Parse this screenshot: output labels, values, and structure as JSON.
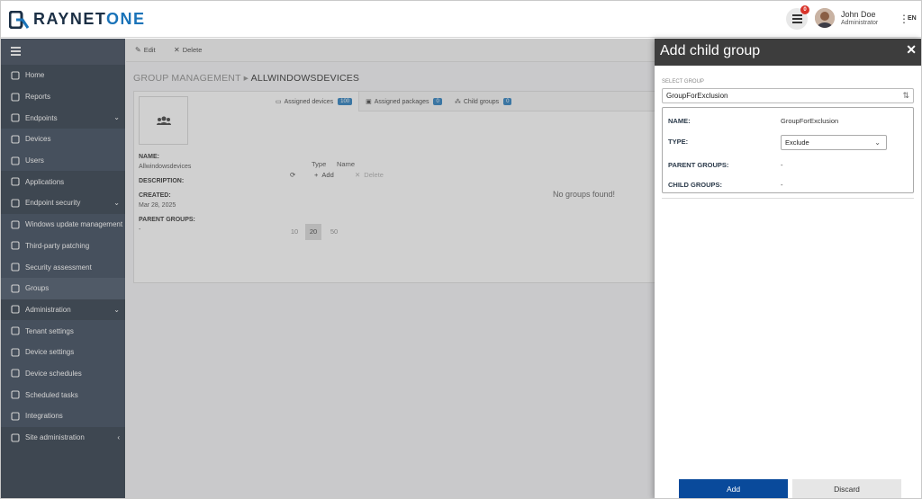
{
  "header": {
    "brand_part1": "RAYNET",
    "brand_part2": "ONE",
    "notification_count": "0",
    "user_name": "John Doe",
    "user_role": "Administrator",
    "language": "EN"
  },
  "sidebar": {
    "items": [
      {
        "label": "Home",
        "icon": "home-icon"
      },
      {
        "label": "Reports",
        "icon": "report-icon"
      },
      {
        "label": "Endpoints",
        "icon": "share-icon",
        "expandable": true
      },
      {
        "label": "Devices",
        "icon": "monitor-icon"
      },
      {
        "label": "Users",
        "icon": "users-icon"
      },
      {
        "label": "Applications",
        "icon": "app-icon"
      },
      {
        "label": "Endpoint security",
        "icon": "shield-icon",
        "expandable": true
      },
      {
        "label": "Windows update management",
        "icon": "windows-icon"
      },
      {
        "label": "Third-party patching",
        "icon": "patch-icon"
      },
      {
        "label": "Security assessment",
        "icon": "lock-icon"
      },
      {
        "label": "Groups",
        "icon": "group-icon",
        "active": true
      },
      {
        "label": "Administration",
        "icon": "admin-icon",
        "expandable": true
      },
      {
        "label": "Tenant settings",
        "icon": "camera-icon"
      },
      {
        "label": "Device settings",
        "icon": "device-settings-icon"
      },
      {
        "label": "Device schedules",
        "icon": "schedule-icon"
      },
      {
        "label": "Scheduled tasks",
        "icon": "tasks-icon"
      },
      {
        "label": "Integrations",
        "icon": "integrations-icon"
      },
      {
        "label": "Site administration",
        "icon": "site-icon",
        "collapsed": true
      }
    ]
  },
  "toolbar": {
    "edit_label": "Edit",
    "delete_label": "Delete"
  },
  "breadcrumb": {
    "parent": "GROUP MANAGEMENT",
    "separator": "▸",
    "current": "ALLWINDOWSDEVICES"
  },
  "group": {
    "name_label": "NAME:",
    "name_value": "Allwindowsdevices",
    "description_label": "DESCRIPTION:",
    "created_label": "CREATED:",
    "created_value": "Mar 28, 2025",
    "parent_groups_label": "PARENT GROUPS:",
    "parent_groups_value": "-"
  },
  "tabs": [
    {
      "label": "Assigned devices",
      "count": "100"
    },
    {
      "label": "Assigned packages",
      "count": "0"
    },
    {
      "label": "Child groups",
      "count": "0"
    }
  ],
  "child_groups": {
    "add_label": "Add",
    "delete_label": "Delete",
    "columns": [
      "Type",
      "Name"
    ],
    "empty_text": "No groups found!",
    "page_sizes": [
      "10",
      "20",
      "50"
    ],
    "selected_page_size": "20"
  },
  "dialog": {
    "title": "Add child group",
    "select_label": "SELECT GROUP",
    "select_value": "GroupForExclusion",
    "name_label": "NAME:",
    "name_value": "GroupForExclusion",
    "type_label": "TYPE:",
    "type_value": "Exclude",
    "parent_groups_label": "PARENT GROUPS:",
    "parent_groups_value": "-",
    "child_groups_label": "CHILD GROUPS:",
    "child_groups_value": "-",
    "add_button": "Add",
    "discard_button": "Discard"
  },
  "colors": {
    "sidebar_bg": "#1f2d3d",
    "primary": "#094a9b",
    "badge_blue": "#1b75bb",
    "notification_red": "#d9342b"
  }
}
